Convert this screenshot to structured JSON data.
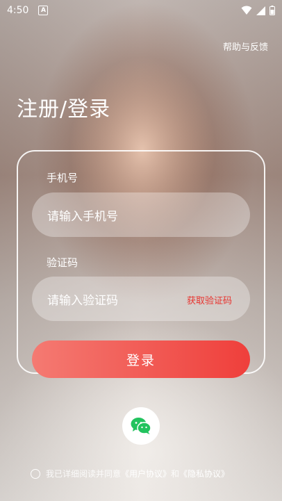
{
  "status_bar": {
    "time": "4:50",
    "badge_letter": "A"
  },
  "header": {
    "help_link": "帮助与反馈",
    "title": "注册/登录"
  },
  "form": {
    "phone_label": "手机号",
    "phone_placeholder": "请输入手机号",
    "code_label": "验证码",
    "code_placeholder": "请输入验证码",
    "get_code": "获取验证码",
    "login_button": "登录"
  },
  "social": {
    "icon": "wechat-icon",
    "brand_color": "#22c35e"
  },
  "agreement": {
    "prefix": "我已详细阅读并同意",
    "user_agreement": "《用户协议》",
    "and": "和",
    "privacy_policy": "《隐私协议》"
  },
  "colors": {
    "accent": "#ef3f3b",
    "accent_light": "#f47a72",
    "get_code": "#e8342f"
  }
}
